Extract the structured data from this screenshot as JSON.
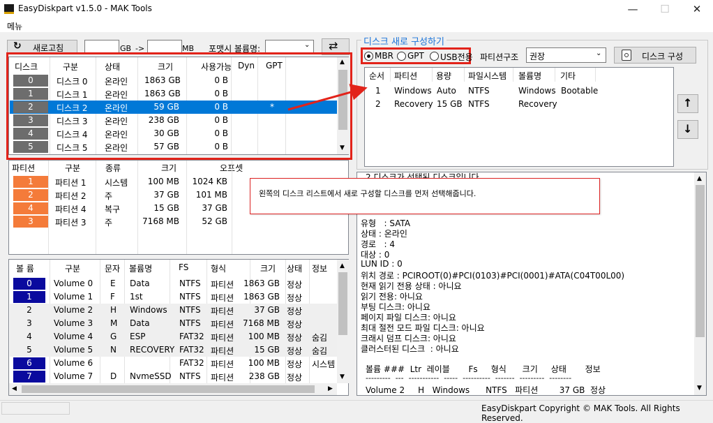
{
  "window": {
    "title": "EasyDiskpart v1.5.0 - MAK Tools",
    "minimize": "—",
    "maximize": "☐",
    "close": "✕"
  },
  "menu": {
    "label": "메뉴"
  },
  "toolbar": {
    "refresh_label": "새로고침",
    "gb_unit": "GB",
    "arrow_label": "->",
    "mb_unit": "MB",
    "format_vol_label": "포맷시 볼륨명:",
    "size_gb_value": "",
    "size_mb_value": "",
    "format_vol_value": ""
  },
  "disk_table": {
    "headers": [
      "디스크",
      "구분",
      "상태",
      "크기",
      "사용가능",
      "Dyn",
      "GPT"
    ],
    "rows": [
      {
        "num": "0",
        "name": "디스크 0",
        "status": "온라인",
        "size": "1863 GB",
        "free": "0 B",
        "dyn": "",
        "gpt": ""
      },
      {
        "num": "1",
        "name": "디스크 1",
        "status": "온라인",
        "size": "1863 GB",
        "free": "0 B",
        "dyn": "",
        "gpt": ""
      },
      {
        "num": "2",
        "name": "디스크 2",
        "status": "온라인",
        "size": "59 GB",
        "free": "0 B",
        "dyn": "",
        "gpt": "*"
      },
      {
        "num": "3",
        "name": "디스크 3",
        "status": "온라인",
        "size": "238 GB",
        "free": "0 B",
        "dyn": "",
        "gpt": ""
      },
      {
        "num": "4",
        "name": "디스크 4",
        "status": "온라인",
        "size": "30 GB",
        "free": "0 B",
        "dyn": "",
        "gpt": ""
      },
      {
        "num": "5",
        "name": "디스크 5",
        "status": "온라인",
        "size": "57 GB",
        "free": "0 B",
        "dyn": "",
        "gpt": ""
      }
    ]
  },
  "partition_table": {
    "headers": [
      "파티션",
      "구분",
      "종류",
      "크기",
      "오프셋"
    ],
    "rows": [
      {
        "num": "1",
        "name": "파티션 1",
        "type": "시스템",
        "size": "100 MB",
        "offset": "1024 KB"
      },
      {
        "num": "2",
        "name": "파티션 2",
        "type": "주",
        "size": "37 GB",
        "offset": "101 MB"
      },
      {
        "num": "4",
        "name": "파티션 4",
        "type": "복구",
        "size": "15 GB",
        "offset": "37 GB"
      },
      {
        "num": "3",
        "name": "파티션 3",
        "type": "주",
        "size": "7168 MB",
        "offset": "52 GB"
      }
    ]
  },
  "volume_table": {
    "headers": [
      "볼 륨",
      "구분",
      "문자",
      "볼륨명",
      "FS",
      "형식",
      "크기",
      "상태",
      "정보"
    ],
    "rows": [
      {
        "num": "0",
        "name": "Volume 0",
        "letter": "E",
        "label": "Data",
        "fs": "NTFS",
        "kind": "파티션",
        "size": "1863 GB",
        "status": "정상",
        "info": "",
        "blue": true
      },
      {
        "num": "1",
        "name": "Volume 1",
        "letter": "F",
        "label": "1st",
        "fs": "NTFS",
        "kind": "파티션",
        "size": "1863 GB",
        "status": "정상",
        "info": "",
        "blue": true
      },
      {
        "num": "2",
        "name": "Volume 2",
        "letter": "H",
        "label": "Windows",
        "fs": "NTFS",
        "kind": "파티션",
        "size": "37 GB",
        "status": "정상",
        "info": "",
        "blue": false
      },
      {
        "num": "3",
        "name": "Volume 3",
        "letter": "M",
        "label": "Data",
        "fs": "NTFS",
        "kind": "파티션",
        "size": "7168 MB",
        "status": "정상",
        "info": "",
        "blue": false
      },
      {
        "num": "4",
        "name": "Volume 4",
        "letter": "G",
        "label": "ESP",
        "fs": "FAT32",
        "kind": "파티션",
        "size": "100 MB",
        "status": "정상",
        "info": "숨김",
        "blue": false
      },
      {
        "num": "5",
        "name": "Volume 5",
        "letter": "N",
        "label": "RECOVERY",
        "fs": "FAT32",
        "kind": "파티션",
        "size": "15 GB",
        "status": "정상",
        "info": "숨김",
        "blue": false
      },
      {
        "num": "6",
        "name": "Volume 6",
        "letter": "",
        "label": "",
        "fs": "FAT32",
        "kind": "파티션",
        "size": "100 MB",
        "status": "정상",
        "info": "시스템",
        "blue": true
      },
      {
        "num": "7",
        "name": "Volume 7",
        "letter": "D",
        "label": "NvmeSSD",
        "fs": "NTFS",
        "kind": "파티션",
        "size": "238 GB",
        "status": "정상",
        "info": "",
        "blue": true
      }
    ]
  },
  "reconfig": {
    "group_title": "디스크 새로 구성하기",
    "options": [
      "MBR",
      "GPT",
      "USB전용"
    ],
    "selected_option": "MBR",
    "structure_label": "파티션구조",
    "structure_value": "권장",
    "build_button": "디스크 구성",
    "headers": [
      "순서",
      "파티션",
      "용량",
      "파일시스템",
      "볼륨명",
      "기타"
    ],
    "rows": [
      {
        "order": "1",
        "partition": "Windows",
        "size": "Auto",
        "fs": "NTFS",
        "label": "Windows",
        "etc": "Bootable"
      },
      {
        "order": "2",
        "partition": "Recovery",
        "size": "15 GB",
        "fs": "NTFS",
        "label": "Recovery",
        "etc": ""
      }
    ],
    "up_icon": "↑",
    "down_icon": "↓"
  },
  "info_panel": {
    "cut_line": "2 디스크가 선택된 디스크입니다.",
    "lines": [
      "유형   : SATA",
      "상태 : 온라인",
      "경로   : 4",
      "대상 : 0",
      "LUN ID : 0",
      "위치 경로 : PCIROOT(0)#PCI(0103)#PCI(0001)#ATA(C04T00L00)",
      "현재 읽기 전용 상태 : 아니요",
      "읽기 전용: 아니요",
      "부팅 디스크: 아니요",
      "페이지 파일 디스크: 아니요",
      "최대 절전 모드 파일 디스크: 아니요",
      "크래시 덤프 디스크: 아니요",
      "클러스터된 디스크  : 아니요"
    ],
    "vol_header": "볼륨 ###  Ltr  레이블       Fs     형식      크기     상태       정보",
    "vol_dashes": "---------  ---  -----------  -----  ----------  -------  ---------  --------",
    "vol_row": "Volume 2     H   Windows      NTFS   파티션        37 GB  정상"
  },
  "callout": {
    "text": "왼쪽의 디스크 리스트에서 새로 구성할 디스크를 먼저 선택해줍니다."
  },
  "status": {
    "copyright": "EasyDiskpart Copyright © MAK Tools. All Rights Reserved."
  },
  "colors": {
    "selection": "#0078d7",
    "red_annotation": "#e2231a",
    "orange": "#f47b3a",
    "gray_num": "#6d6d6d",
    "blue_num": "#0a0a9e"
  }
}
